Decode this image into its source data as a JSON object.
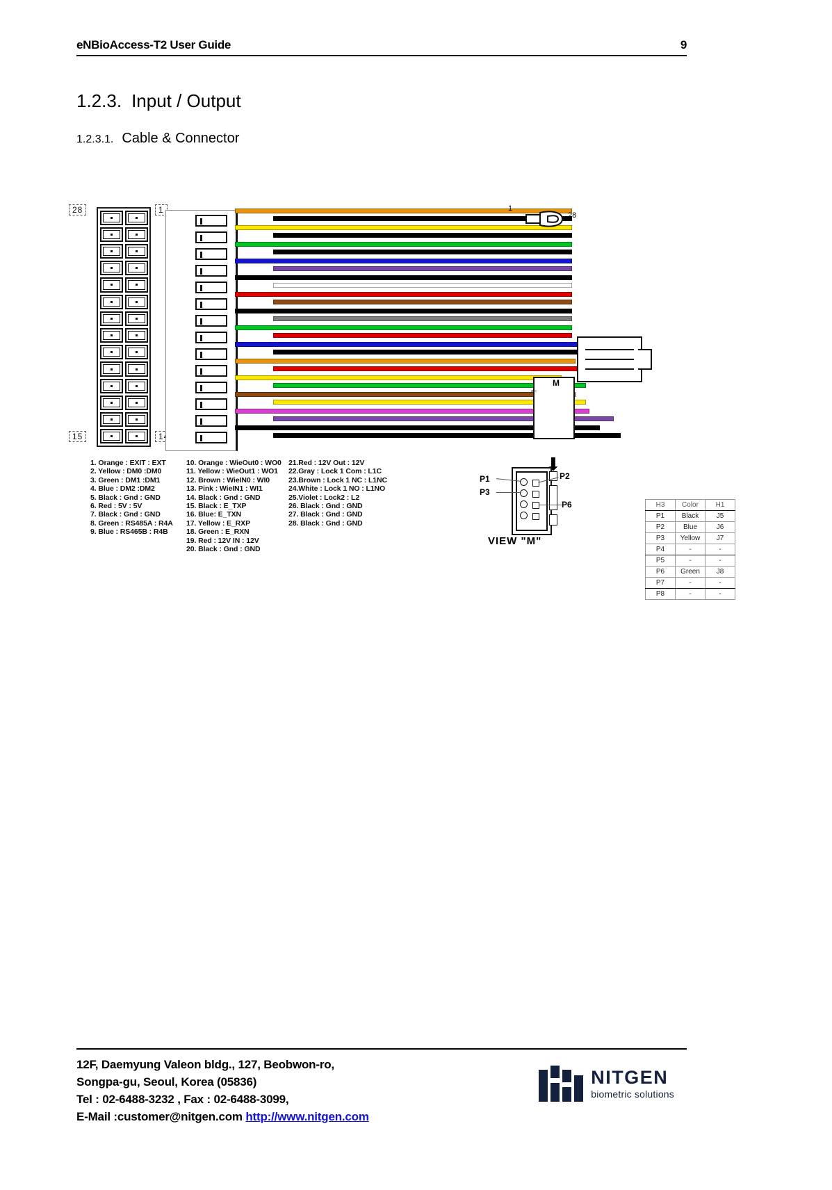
{
  "header": {
    "title": "eNBioAccess-T2 User Guide",
    "page_number": "9"
  },
  "headings": {
    "section_number": "1.2.3.",
    "section_title": "Input / Output",
    "sub_number": "1.2.3.1.",
    "sub_title": "Cable & Connector"
  },
  "figure": {
    "connector_labels": {
      "top_left": "28",
      "top_right": "1",
      "bottom_left": "15",
      "bottom_right": "14"
    },
    "wire_end_labels": {
      "first": "1",
      "last": "28"
    },
    "callout_m": "M",
    "view_caption": "VIEW \"M\"",
    "view_pins": [
      "P1",
      "P2",
      "P3",
      "P6"
    ]
  },
  "legend": {
    "column1": [
      "1. Orange : EXIT : EXT",
      "2. Yellow : DM0 :DM0",
      "3. Green : DM1 :DM1",
      "4. Blue : DM2 :DM2",
      "5. Black : Gnd : GND",
      "6. Red : 5V : 5V",
      "7. Black : Gnd : GND",
      "8. Green : RS485A : R4A",
      "9. Blue : RS465B : R4B"
    ],
    "column2": [
      "10. Orange : WieOut0 : WO0",
      "11. Yellow : WieOut1 : WO1",
      "12. Brown : WieIN0 : WI0",
      "13. Pink : WieIN1 : WI1",
      "14. Black : Gnd : GND",
      "15. Black : E_TXP",
      "16. Blue: E_TXN",
      "17. Yellow : E_RXP",
      "18. Green : E_RXN",
      "19. Red : 12V IN : 12V",
      "20. Black : Gnd : GND"
    ],
    "column3": [
      "21.Red : 12V Out : 12V",
      "22.Gray : Lock 1 Com : L1C",
      "23.Brown : Lock 1 NC : L1NC",
      "24.White : Lock 1 NO : L1NO",
      "25.Violet : Lock2 : L2",
      "26. Black : Gnd : GND",
      "27. Black : Gnd : GND",
      "28. Black : Gnd : GND"
    ]
  },
  "pin_table": {
    "headers": [
      "H3",
      "Color",
      "H1"
    ],
    "rows": [
      [
        "P1",
        "Black",
        "J5"
      ],
      [
        "P2",
        "Blue",
        "J6"
      ],
      [
        "P3",
        "Yellow",
        "J7"
      ],
      [
        "P4",
        "-",
        "-"
      ],
      [
        "P5",
        "-",
        "-"
      ],
      [
        "P6",
        "Green",
        "J8"
      ],
      [
        "P7",
        "-",
        "-"
      ],
      [
        "P8",
        "-",
        "-"
      ]
    ]
  },
  "wire_colors": [
    "#e8930c",
    "#000000",
    "#ffe800",
    "#000000",
    "#00c522",
    "#000000",
    "#1414d2",
    "#7b48a8",
    "#000000",
    "#ffffff",
    "#e00000",
    "#8a4a12",
    "#000000",
    "#808080",
    "#00c522",
    "#e00000",
    "#1414d2",
    "#000000",
    "#e8930c",
    "#e00000",
    "#ffe800",
    "#00c522",
    "#8a4a12",
    "#ffe800",
    "#d93fd0",
    "#7b48a8",
    "#000000",
    "#000000"
  ],
  "footer": {
    "lines": [
      "12F, Daemyung Valeon bldg., 127, Beobwon-ro,",
      "Songpa-gu, Seoul, Korea (05836)",
      "Tel : 02-6488-3232 , Fax : 02-6488-3099,"
    ],
    "email_line_prefix": "E-Mail :customer@nitgen.com ",
    "website": "http://www.nitgen.com",
    "logo_name": "NITGEN",
    "logo_tagline": "biometric solutions",
    "logo_color": "#14213d"
  }
}
